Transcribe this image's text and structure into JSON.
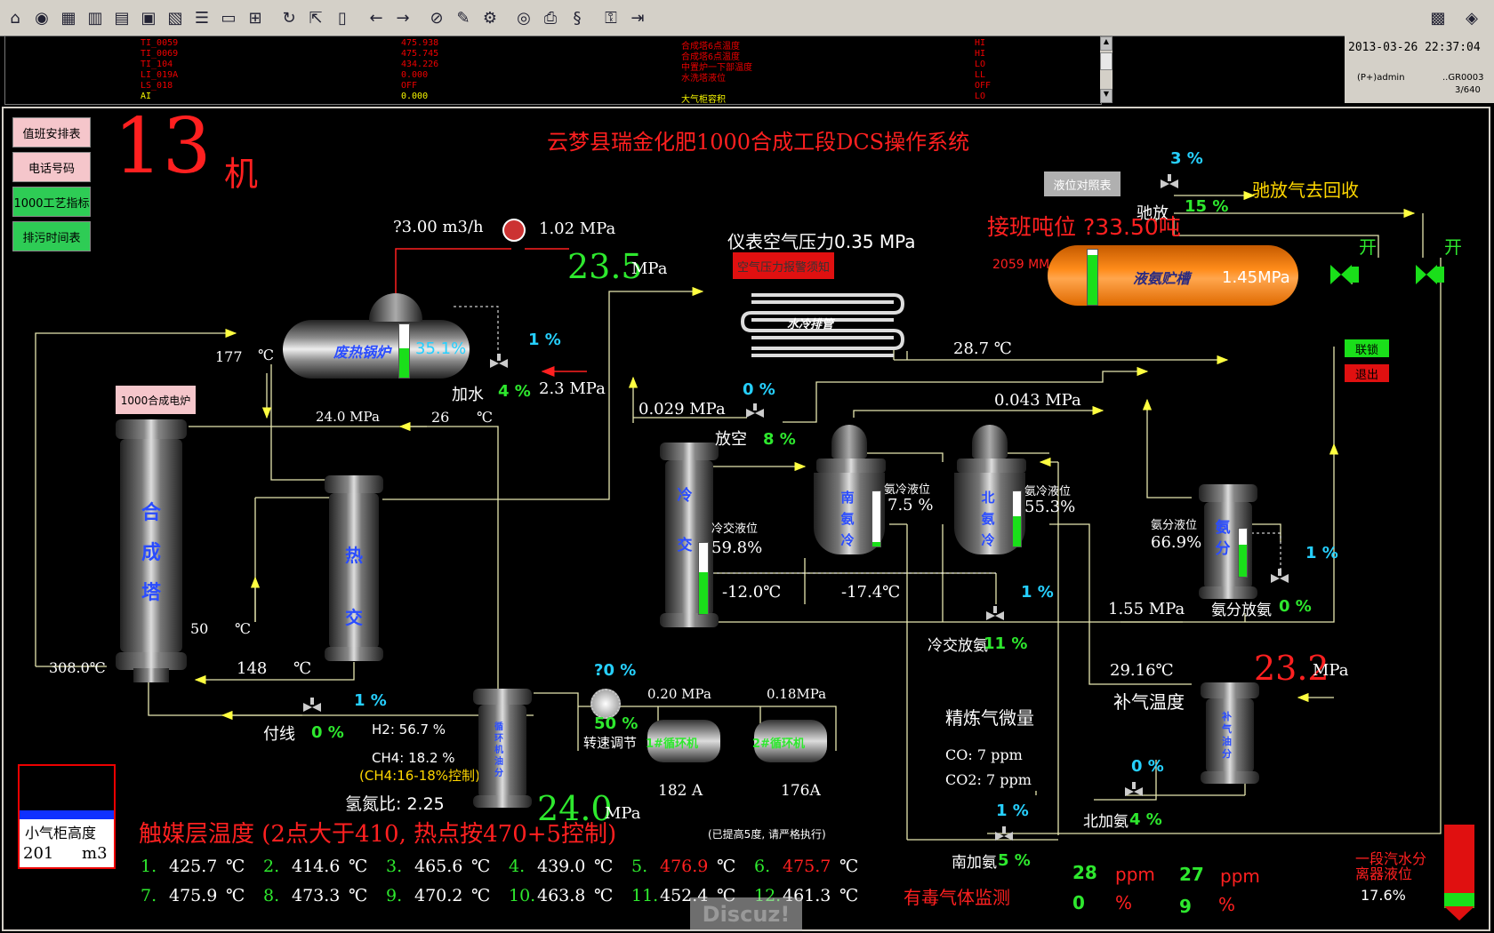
{
  "toolbar": {
    "icons": [
      "home-icon",
      "globe-icon",
      "grid-icon",
      "bars-icon",
      "table-icon",
      "trend-icon",
      "report-icon",
      "list-icon",
      "panel-icon",
      "network-icon",
      "refresh-icon",
      "export-icon",
      "book-icon",
      "back-icon",
      "forward-icon",
      "alarm-icon",
      "edit-icon",
      "config-icon",
      "binoculars-icon",
      "print-icon",
      "sync-icon",
      "key-icon",
      "logout-icon"
    ]
  },
  "alarms": [
    {
      "tag": "TI_0059",
      "value": "475.938",
      "desc": "合成塔6点温度",
      "level": "HI"
    },
    {
      "tag": "TI_0069",
      "value": "475.745",
      "desc": "合成塔6点温度",
      "level": "HI"
    },
    {
      "tag": "TI_104",
      "value": "434.226",
      "desc": "中置炉一下部温度",
      "level": "LO"
    },
    {
      "tag": "LI_019A",
      "value": "0.000",
      "desc": "水洗塔液位",
      "level": "LL"
    },
    {
      "tag": "LS_018",
      "value": "OFF",
      "desc": "",
      "level": "OFF"
    },
    {
      "tag": "AI",
      "value": "0.000",
      "desc": "大气柜容积",
      "level": "LO"
    }
  ],
  "status": {
    "datetime": "2013-03-26 22:37:04",
    "user": "(P+)admin",
    "group": "..GR0003",
    "page": "3/640"
  },
  "left_buttons": [
    {
      "label": "值班安排表",
      "color": "#f5c6cb"
    },
    {
      "label": "电话号码",
      "color": "#f5c6cb"
    },
    {
      "label": "1000工艺指标",
      "color": "#2ecc55"
    },
    {
      "label": "排污时间表",
      "color": "#2ecc55"
    }
  ],
  "machine": {
    "number": "13",
    "suffix": "机"
  },
  "title": "云梦县瑞金化肥1000合成工段DCS操作系统",
  "labels": {
    "flow": "?3.00  m3/h",
    "p_top": "1.02  MPa",
    "p_big1": "23.5",
    "p_big1_unit": "MPa",
    "instr_air": "仪表空气压力0.35 MPa",
    "air_alarm": "空气压力报警须知",
    "water_cooler": "水冷排管",
    "t_287": "28.7 ℃",
    "boiler": "废热锅炉",
    "boiler_pct": "35.1%",
    "t_177": "177",
    "deg": "℃",
    "add_water": "加水",
    "add_water_pct": "4 %",
    "p_add": "2.3 MPa",
    "valve1_pct": "1 %",
    "furnace": "1000合成电炉",
    "p_240": "24.0 MPa",
    "t_26": "26",
    "p_0029": "0.029 MPa",
    "vent_pct_top": "0 %",
    "vent": "放空",
    "vent_pct": "8 %",
    "p_0043": "0.043 MPa",
    "synth_tower": [
      "合",
      "成",
      "塔"
    ],
    "heat_ex": [
      "热",
      "交"
    ],
    "cold_ex": [
      "冷",
      "交"
    ],
    "south_cooler": [
      "南",
      "氨",
      "冷"
    ],
    "north_cooler": [
      "北",
      "氨",
      "冷"
    ],
    "sep": [
      "氨",
      "分"
    ],
    "t_50": "50",
    "t_308": "308.0℃",
    "t_148": "148",
    "side_line": "付线",
    "side_pct": "0 %",
    "side_valve_pct": "1 %",
    "coldex_level_lbl": "冷交液位",
    "coldex_level": "59.8%",
    "south_level_lbl": "氨冷液位",
    "south_level": "7.5 %",
    "north_level_lbl": "氨冷液位",
    "north_level": "55.3%",
    "sep_level_lbl": "氨分液位",
    "sep_level": "66.9%",
    "t_m12": "-12.0℃",
    "t_m174": "-17.4℃",
    "coldex_release": "冷交放氨",
    "coldex_release_pct": "11 %",
    "coldex_valve_pct": "1 %",
    "p_155": "1.55 MPa",
    "sep_release": "氨分放氨",
    "sep_release_pct": "0 %",
    "sep_valve_pct": "1 %",
    "h2": "H2: 56.7 %",
    "ch4": "CH4: 18.2 %",
    "ch4_ctrl": "(CH4:16-18%控制)",
    "ratio": "氢氮比: 2.25",
    "recycle_sep": "循环机油分",
    "p_big2": "24.0",
    "p_big2_unit": "MPa",
    "speed_pct_top": "?0 %",
    "speed_pct": "50 %",
    "speed_ctrl": "转速调节",
    "comp1_p": "0.20 MPa",
    "comp2_p": "0.18MPa",
    "comp1": "1#循环机",
    "comp2": "2#循环机",
    "comp1_a": "182 A",
    "comp2_a": "176A",
    "t_2916": "29.16℃",
    "makeup_temp": "补气温度",
    "p_big3": "23.2",
    "p_big3_unit": "MPa",
    "makeup_sep": "补气油分",
    "refined_gas": "精炼气微量",
    "co": "CO:  7   ppm",
    "co2": "CO2:  7   ppm",
    "north_add_pct_top": "0 %",
    "north_add": "北加氨",
    "north_add_pct": "4 %",
    "south_add_pct_top": "1 %",
    "south_add": "南加氨",
    "south_add_pct": "5 %",
    "level_cmp": "液位对照表",
    "purge_pct_top": "3 %",
    "purge": "驰放",
    "purge_pct": "15 %",
    "purge_to": "驰放气去回收",
    "handover_level": "接班吨位 ?33.50吨",
    "tank_mm": "2059 MM",
    "ammonia_tank": "液氨贮槽",
    "tank_p": "1.45MPa",
    "open1": "开",
    "open2": "开",
    "interlock": "联锁",
    "exit": "退出",
    "gasholder_lbl": "小气柜高度",
    "gasholder_val": "201",
    "gasholder_unit": "m3",
    "catalyst_title": "触媒层温度 (2点大于410, 热点按470+5控制)",
    "catalyst_note": "(已提高5度, 请严格执行)",
    "toxic": "有毒气体监测",
    "toxic_vals": [
      "28",
      "ppm",
      "27",
      "ppm",
      "0",
      "%",
      "9",
      "%"
    ],
    "sep1_label": "一段汽水分离器液位",
    "sep1_val": "17.6%",
    "watermark": "Discuz!"
  },
  "catalyst_temps": [
    {
      "n": "1.",
      "v": "425.7",
      "alarm": false
    },
    {
      "n": "2.",
      "v": "414.6",
      "alarm": false
    },
    {
      "n": "3.",
      "v": "465.6",
      "alarm": false
    },
    {
      "n": "4.",
      "v": "439.0",
      "alarm": false
    },
    {
      "n": "5.",
      "v": "476.9",
      "alarm": true
    },
    {
      "n": "6.",
      "v": "475.7",
      "alarm": true
    },
    {
      "n": "7.",
      "v": "475.9",
      "alarm": false
    },
    {
      "n": "8.",
      "v": "473.3",
      "alarm": false
    },
    {
      "n": "9.",
      "v": "470.2",
      "alarm": false
    },
    {
      "n": "10.",
      "v": "463.8",
      "alarm": false
    },
    {
      "n": "11.",
      "v": "452.4",
      "alarm": false
    },
    {
      "n": "12.",
      "v": "461.3",
      "alarm": false
    }
  ],
  "levels": {
    "boiler": 0.55,
    "coldex": 0.59,
    "south": 0.08,
    "north": 0.55,
    "sep": 0.67,
    "tank": 0.9,
    "gasholder": 0.3,
    "sep1": 0.18
  }
}
